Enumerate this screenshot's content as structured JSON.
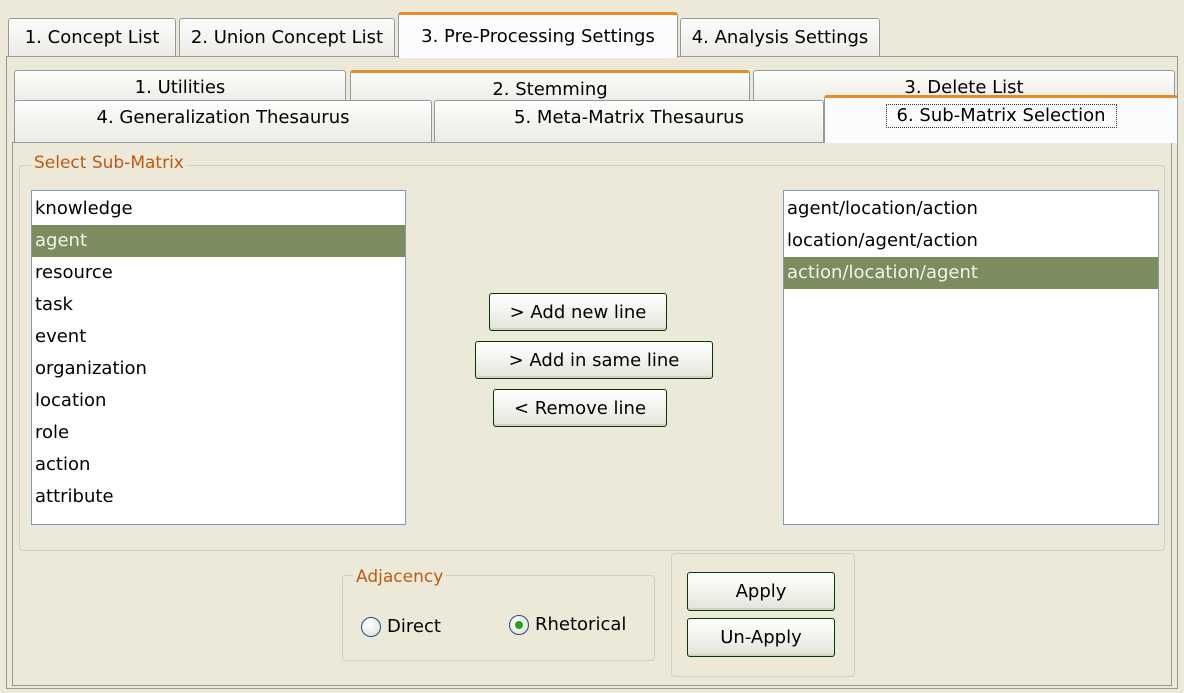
{
  "outer_tabs": [
    {
      "label": "1. Concept List"
    },
    {
      "label": "2. Union Concept List"
    },
    {
      "label": "3. Pre-Processing Settings"
    },
    {
      "label": "4. Analysis Settings"
    }
  ],
  "inner_tabs": [
    {
      "label": "1. Utilities"
    },
    {
      "label": "2. Stemming"
    },
    {
      "label": "3. Delete List"
    },
    {
      "label": "4. Generalization Thesaurus"
    },
    {
      "label": "5. Meta-Matrix Thesaurus"
    },
    {
      "label": "6. Sub-Matrix Selection"
    }
  ],
  "submatrix": {
    "group_title": "Select Sub-Matrix",
    "source_items": [
      "knowledge",
      "agent",
      "resource",
      "task",
      "event",
      "organization",
      "location",
      "role",
      "action",
      "attribute"
    ],
    "source_selected": "agent",
    "target_items": [
      "agent/location/action",
      "location/agent/action",
      "action/location/agent"
    ],
    "target_selected": "action/location/agent",
    "add_new_line_label": "> Add new line",
    "add_same_line_label": "> Add in same line",
    "remove_line_label": "< Remove line"
  },
  "adjacency": {
    "title": "Adjacency",
    "options": [
      {
        "label": "Direct",
        "checked": false
      },
      {
        "label": "Rhetorical",
        "checked": true
      }
    ]
  },
  "actions": {
    "apply_label": "Apply",
    "unapply_label": "Un-Apply"
  }
}
